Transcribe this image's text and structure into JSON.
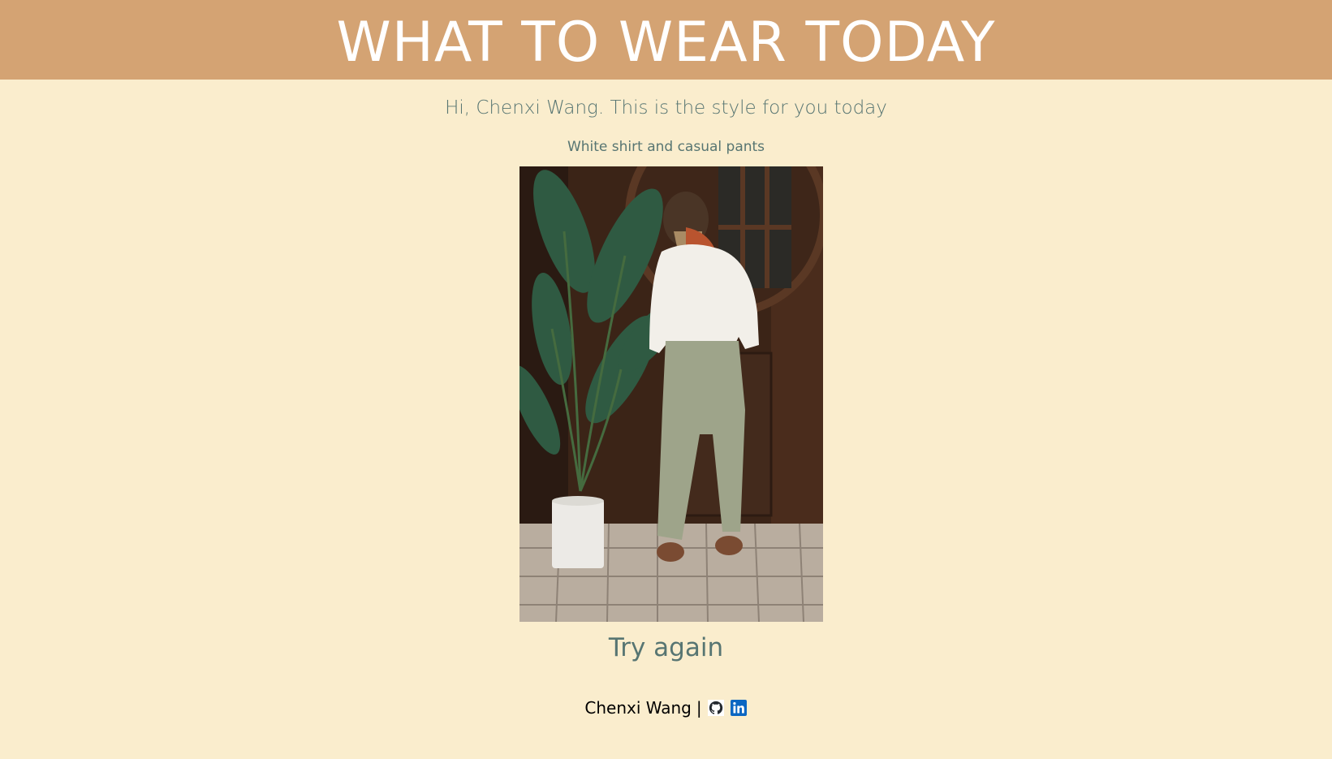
{
  "header": {
    "title": "WHAT TO WEAR TODAY"
  },
  "main": {
    "greeting": "Hi, Chenxi Wang. This is the style for you today",
    "style_description": "White shirt and casual pants",
    "outfit_image": {
      "icon": "outfit-photo"
    },
    "try_again_label": "Try again"
  },
  "footer": {
    "author": "Chenxi Wang",
    "separator": "|",
    "links": [
      {
        "icon": "github-icon"
      },
      {
        "icon": "linkedin-icon"
      }
    ]
  },
  "colors": {
    "header_bg": "#D4A373",
    "page_bg": "#FAEDCD",
    "text_accent": "#577572",
    "linkedin_blue": "#0A66C2"
  }
}
